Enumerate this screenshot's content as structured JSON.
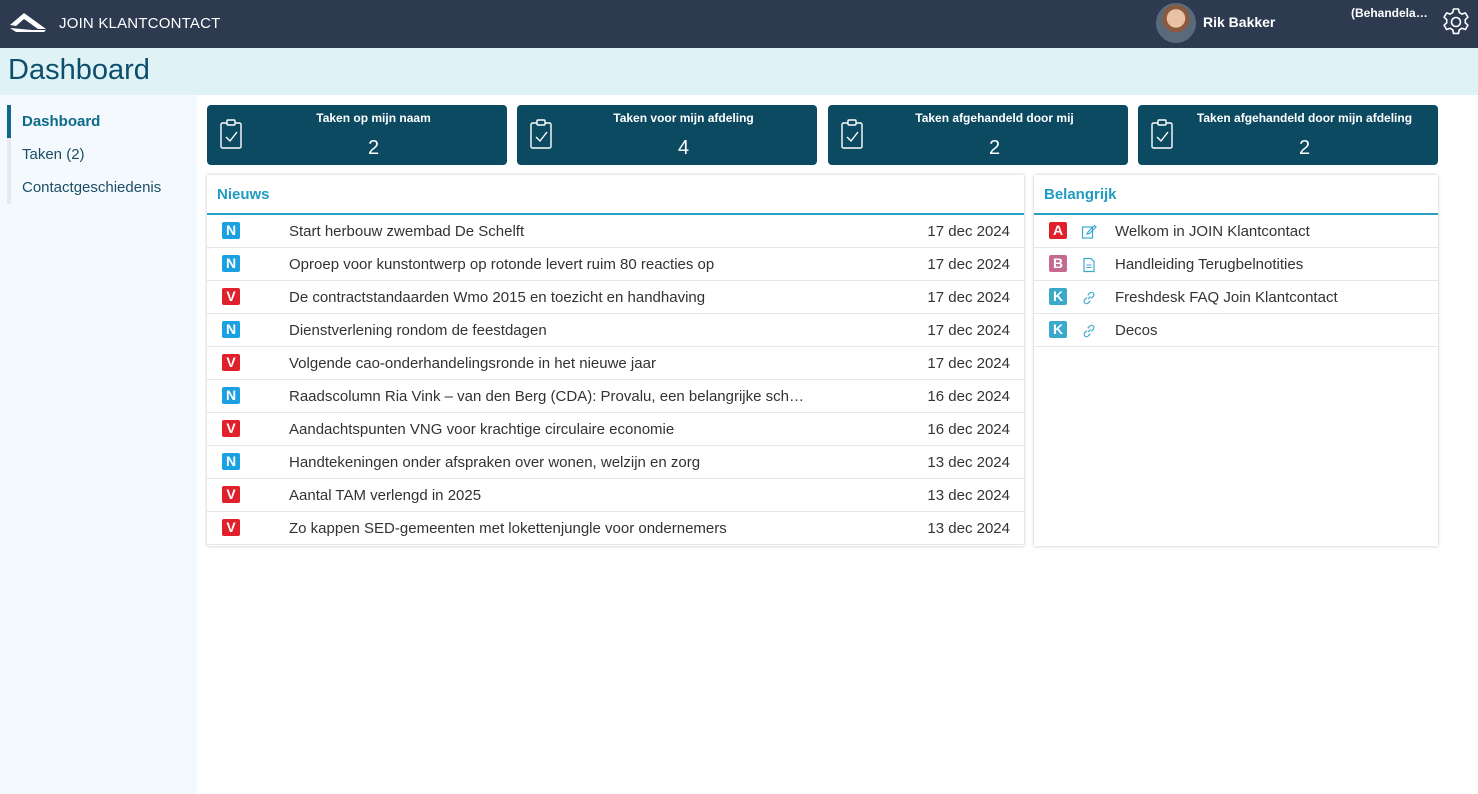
{
  "app": {
    "title": "JOIN KLANTCONTACT"
  },
  "user": {
    "name": "Rik Bakker",
    "role": "(Behandelaar)"
  },
  "page": {
    "title": "Dashboard"
  },
  "sidebar": {
    "items": [
      {
        "label": "Dashboard",
        "active": true
      },
      {
        "label": "Taken (2)",
        "active": false
      },
      {
        "label": "Contactgeschiedenis",
        "active": false
      }
    ]
  },
  "tiles": [
    {
      "label": "Taken op mijn naam",
      "count": "2"
    },
    {
      "label": "Taken voor mijn afdeling",
      "count": "4"
    },
    {
      "label": "Taken afgehandeld door mij",
      "count": "2"
    },
    {
      "label": "Taken afgehandeld door mijn afdeling",
      "count": "2"
    }
  ],
  "news": {
    "title": "Nieuws",
    "items": [
      {
        "badge": "N",
        "title": "Start herbouw zwembad De Schelft",
        "date": "17 dec 2024"
      },
      {
        "badge": "N",
        "title": "Oproep voor kunstontwerp op rotonde levert ruim 80 reacties op",
        "date": "17 dec 2024"
      },
      {
        "badge": "V",
        "title": "De contractstandaarden Wmo 2015 en toezicht en handhaving",
        "date": "17 dec 2024"
      },
      {
        "badge": "N",
        "title": "Dienstverlening rondom de feestdagen",
        "date": "17 dec 2024"
      },
      {
        "badge": "V",
        "title": "Volgende cao-onderhandelingsronde in het nieuwe jaar",
        "date": "17 dec 2024"
      },
      {
        "badge": "N",
        "title": "Raadscolumn Ria Vink – van den Berg (CDA): Provalu, een belangrijke schakel",
        "date": "16 dec 2024"
      },
      {
        "badge": "V",
        "title": "Aandachtspunten VNG voor krachtige circulaire economie",
        "date": "16 dec 2024"
      },
      {
        "badge": "N",
        "title": "Handtekeningen onder afspraken over wonen, welzijn en zorg",
        "date": "13 dec 2024"
      },
      {
        "badge": "V",
        "title": "Aantal TAM verlengd in 2025",
        "date": "13 dec 2024"
      },
      {
        "badge": "V",
        "title": "Zo kappen SED-gemeenten met lokettenjungle voor ondernemers",
        "date": "13 dec 2024"
      }
    ]
  },
  "important": {
    "title": "Belangrijk",
    "items": [
      {
        "badge": "A",
        "icon": "edit-icon",
        "title": "Welkom in JOIN Klantcontact"
      },
      {
        "badge": "B",
        "icon": "document-icon",
        "title": "Handleiding Terugbelnotities"
      },
      {
        "badge": "K",
        "icon": "link-icon",
        "title": "Freshdesk FAQ Join Klantcontact"
      },
      {
        "badge": "K",
        "icon": "link-icon",
        "title": "Decos"
      }
    ]
  },
  "colors": {
    "topbar": "#2d3a50",
    "tile": "#0c4a62",
    "accent": "#1f9cc1",
    "badge_N": "#1ba0e1",
    "badge_V": "#e0202a",
    "badge_A": "#e0202a",
    "badge_B": "#c46a8e",
    "badge_K": "#3ba9cc"
  }
}
